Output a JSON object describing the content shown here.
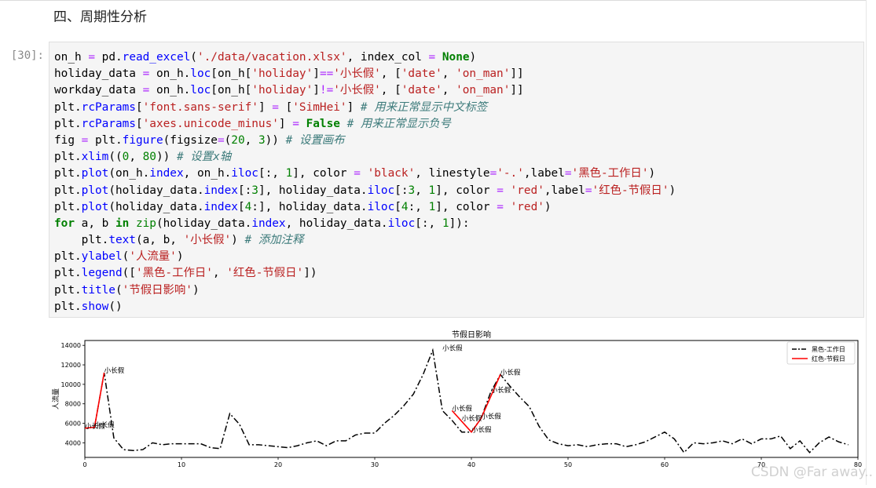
{
  "heading": "四、周期性分析",
  "cell": {
    "prompt": "[30]:",
    "lines": [
      [
        [
          "on_h ",
          ""
        ],
        [
          "=",
          "o"
        ],
        [
          " pd.",
          ""
        ],
        [
          "read_excel",
          "f"
        ],
        [
          "(",
          ""
        ],
        [
          "'./data/vacation.xlsx'",
          "s"
        ],
        [
          ", index_col ",
          ""
        ],
        [
          "=",
          "o"
        ],
        [
          " ",
          ""
        ],
        [
          "None",
          "k"
        ],
        [
          ")",
          ""
        ]
      ],
      [
        [
          "holiday_data ",
          ""
        ],
        [
          "=",
          "o"
        ],
        [
          " on_h.",
          ""
        ],
        [
          "loc",
          "f"
        ],
        [
          "[on_h[",
          ""
        ],
        [
          "'holiday'",
          "s"
        ],
        [
          "]",
          ""
        ],
        [
          "==",
          "o"
        ],
        [
          "'小长假'",
          "s"
        ],
        [
          ", [",
          ""
        ],
        [
          "'date'",
          "s"
        ],
        [
          ", ",
          ""
        ],
        [
          "'on_man'",
          "s"
        ],
        [
          "]]",
          ""
        ]
      ],
      [
        [
          "workday_data ",
          ""
        ],
        [
          "=",
          "o"
        ],
        [
          " on_h.",
          ""
        ],
        [
          "loc",
          "f"
        ],
        [
          "[on_h[",
          ""
        ],
        [
          "'holiday'",
          "s"
        ],
        [
          "]",
          ""
        ],
        [
          "!=",
          "o"
        ],
        [
          "'小长假'",
          "s"
        ],
        [
          ", [",
          ""
        ],
        [
          "'date'",
          "s"
        ],
        [
          ", ",
          ""
        ],
        [
          "'on_man'",
          "s"
        ],
        [
          "]]",
          ""
        ]
      ],
      [
        [
          "plt.",
          ""
        ],
        [
          "rcParams",
          "f"
        ],
        [
          "[",
          ""
        ],
        [
          "'font.sans-serif'",
          "s"
        ],
        [
          "] ",
          ""
        ],
        [
          "=",
          "o"
        ],
        [
          " [",
          ""
        ],
        [
          "'SimHei'",
          "s"
        ],
        [
          "] ",
          ""
        ],
        [
          "# 用来正常显示中文标签",
          "c"
        ]
      ],
      [
        [
          "plt.",
          ""
        ],
        [
          "rcParams",
          "f"
        ],
        [
          "[",
          ""
        ],
        [
          "'axes.unicode_minus'",
          "s"
        ],
        [
          "] ",
          ""
        ],
        [
          "=",
          "o"
        ],
        [
          " ",
          ""
        ],
        [
          "False",
          "k"
        ],
        [
          " ",
          ""
        ],
        [
          "# 用来正常显示负号",
          "c"
        ]
      ],
      [
        [
          "fig ",
          ""
        ],
        [
          "=",
          "o"
        ],
        [
          " plt.",
          ""
        ],
        [
          "figure",
          "f"
        ],
        [
          "(figsize",
          ""
        ],
        [
          "=",
          "o"
        ],
        [
          "(",
          ""
        ],
        [
          "20",
          "m"
        ],
        [
          ", ",
          ""
        ],
        [
          "3",
          "m"
        ],
        [
          ")) ",
          ""
        ],
        [
          "# 设置画布",
          "c"
        ]
      ],
      [
        [
          "plt.",
          ""
        ],
        [
          "xlim",
          "f"
        ],
        [
          "((",
          ""
        ],
        [
          "0",
          "m"
        ],
        [
          ", ",
          ""
        ],
        [
          "80",
          "m"
        ],
        [
          ")) ",
          ""
        ],
        [
          "# 设置x轴",
          "c"
        ]
      ],
      [
        [
          "plt.",
          ""
        ],
        [
          "plot",
          "f"
        ],
        [
          "(on_h.",
          ""
        ],
        [
          "index",
          "f"
        ],
        [
          ", on_h.",
          ""
        ],
        [
          "iloc",
          "f"
        ],
        [
          "[:, ",
          ""
        ],
        [
          "1",
          "m"
        ],
        [
          "], color ",
          ""
        ],
        [
          "=",
          "o"
        ],
        [
          " ",
          ""
        ],
        [
          "'black'",
          "s"
        ],
        [
          ", linestyle",
          ""
        ],
        [
          "=",
          "o"
        ],
        [
          "'-.'",
          "s"
        ],
        [
          ",label",
          ""
        ],
        [
          "=",
          "o"
        ],
        [
          "'黑色-工作日'",
          "s"
        ],
        [
          ")",
          ""
        ]
      ],
      [
        [
          "plt.",
          ""
        ],
        [
          "plot",
          "f"
        ],
        [
          "(holiday_data.",
          ""
        ],
        [
          "index",
          "f"
        ],
        [
          "[:",
          ""
        ],
        [
          "3",
          "m"
        ],
        [
          "], holiday_data.",
          ""
        ],
        [
          "iloc",
          "f"
        ],
        [
          "[:",
          ""
        ],
        [
          "3",
          "m"
        ],
        [
          ", ",
          ""
        ],
        [
          "1",
          "m"
        ],
        [
          "], color ",
          ""
        ],
        [
          "=",
          "o"
        ],
        [
          " ",
          ""
        ],
        [
          "'red'",
          "s"
        ],
        [
          ",label",
          ""
        ],
        [
          "=",
          "o"
        ],
        [
          "'红色-节假日'",
          "s"
        ],
        [
          ")",
          ""
        ]
      ],
      [
        [
          "plt.",
          ""
        ],
        [
          "plot",
          "f"
        ],
        [
          "(holiday_data.",
          ""
        ],
        [
          "index",
          "f"
        ],
        [
          "[",
          ""
        ],
        [
          "4",
          "m"
        ],
        [
          ":], holiday_data.",
          ""
        ],
        [
          "iloc",
          "f"
        ],
        [
          "[",
          ""
        ],
        [
          "4",
          "m"
        ],
        [
          ":, ",
          ""
        ],
        [
          "1",
          "m"
        ],
        [
          "], color ",
          ""
        ],
        [
          "=",
          "o"
        ],
        [
          " ",
          ""
        ],
        [
          "'red'",
          "s"
        ],
        [
          ")",
          ""
        ]
      ],
      [
        [
          "for",
          "k"
        ],
        [
          " a, b ",
          ""
        ],
        [
          "in",
          "k"
        ],
        [
          " ",
          ""
        ],
        [
          "zip",
          "n"
        ],
        [
          "(holiday_data.",
          ""
        ],
        [
          "index",
          "f"
        ],
        [
          ", holiday_data.",
          ""
        ],
        [
          "iloc",
          "f"
        ],
        [
          "[:, ",
          ""
        ],
        [
          "1",
          "m"
        ],
        [
          "]):",
          ""
        ]
      ],
      [
        [
          "    plt.",
          ""
        ],
        [
          "text",
          "f"
        ],
        [
          "(a, b, ",
          ""
        ],
        [
          "'小长假'",
          "s"
        ],
        [
          ") ",
          ""
        ],
        [
          "# 添加注释",
          "c"
        ]
      ],
      [
        [
          "plt.",
          ""
        ],
        [
          "ylabel",
          "f"
        ],
        [
          "(",
          ""
        ],
        [
          "'人流量'",
          "s"
        ],
        [
          ")",
          ""
        ]
      ],
      [
        [
          "plt.",
          ""
        ],
        [
          "legend",
          "f"
        ],
        [
          "([",
          ""
        ],
        [
          "'黑色-工作日'",
          "s"
        ],
        [
          ", ",
          ""
        ],
        [
          "'红色-节假日'",
          "s"
        ],
        [
          "])",
          ""
        ]
      ],
      [
        [
          "plt.",
          ""
        ],
        [
          "title",
          "f"
        ],
        [
          "(",
          ""
        ],
        [
          "'节假日影响'",
          "s"
        ],
        [
          ")",
          ""
        ]
      ],
      [
        [
          "plt.",
          ""
        ],
        [
          "show",
          "f"
        ],
        [
          "()",
          ""
        ]
      ]
    ]
  },
  "chart_data": {
    "type": "line",
    "title": "节假日影响",
    "ylabel": "人流量",
    "xlabel": "",
    "xlim": [
      0,
      80
    ],
    "ylim": [
      2500,
      14500
    ],
    "xticks": [
      0,
      10,
      20,
      30,
      40,
      50,
      60,
      70,
      80
    ],
    "yticks": [
      4000,
      6000,
      8000,
      10000,
      12000,
      14000
    ],
    "legend_position": "top-right",
    "series": [
      {
        "name": "黑色-工作日",
        "color": "#000000",
        "linestyle": "dashdot",
        "x": [
          0,
          1,
          2,
          3,
          4,
          5,
          6,
          7,
          8,
          9,
          10,
          11,
          12,
          13,
          14,
          15,
          16,
          17,
          18,
          19,
          20,
          21,
          22,
          23,
          24,
          25,
          26,
          27,
          28,
          29,
          30,
          31,
          32,
          33,
          34,
          35,
          36,
          37,
          38,
          39,
          40,
          41,
          42,
          43,
          44,
          45,
          46,
          47,
          48,
          49,
          50,
          51,
          52,
          53,
          54,
          55,
          56,
          57,
          58,
          59,
          60,
          61,
          62,
          63,
          64,
          65,
          66,
          67,
          68,
          69,
          70,
          71,
          72,
          73,
          74,
          75,
          76,
          77,
          78,
          79
        ],
        "y": [
          5500,
          5600,
          11200,
          4500,
          3300,
          3200,
          3300,
          4000,
          3800,
          3900,
          3900,
          3900,
          3900,
          3500,
          3400,
          7000,
          5900,
          3800,
          3800,
          3700,
          3600,
          3500,
          3700,
          4000,
          4200,
          3700,
          4200,
          4200,
          4800,
          5000,
          5000,
          6000,
          6800,
          7800,
          9000,
          11000,
          13500,
          7300,
          6300,
          5100,
          5100,
          6500,
          9200,
          11000,
          9800,
          8700,
          7700,
          5700,
          4300,
          3900,
          3700,
          3800,
          3600,
          3800,
          3900,
          3900,
          3600,
          3800,
          4100,
          4600,
          5100,
          4400,
          3000,
          4000,
          3900,
          4000,
          4200,
          3900,
          4400,
          3900,
          4400,
          4400,
          4700,
          3400,
          4200,
          3000,
          4000,
          4600,
          4100,
          3800
        ]
      },
      {
        "name": "红色-节假日",
        "color": "#ff0000",
        "linestyle": "solid",
        "segments": [
          {
            "x": [
              0,
              1,
              2
            ],
            "y": [
              5500,
              5600,
              11200
            ]
          },
          {
            "x": [
              38,
              40,
              41,
              43
            ],
            "y": [
              7300,
              5100,
              6500,
              11000
            ]
          }
        ]
      }
    ],
    "annotations": [
      {
        "x": 0,
        "y": 5500,
        "text": "小长假"
      },
      {
        "x": 1,
        "y": 5600,
        "text": "小长假"
      },
      {
        "x": 2,
        "y": 11200,
        "text": "小长假"
      },
      {
        "x": 37,
        "y": 13500,
        "text": "小长假"
      },
      {
        "x": 38,
        "y": 7300,
        "text": "小长假"
      },
      {
        "x": 39,
        "y": 6300,
        "text": "小长假"
      },
      {
        "x": 40,
        "y": 5100,
        "text": "小长假"
      },
      {
        "x": 41,
        "y": 6500,
        "text": "小长假"
      },
      {
        "x": 42,
        "y": 9200,
        "text": "小长假"
      },
      {
        "x": 43,
        "y": 11000,
        "text": "小长假"
      }
    ]
  },
  "watermark": "CSDN @Far away.."
}
